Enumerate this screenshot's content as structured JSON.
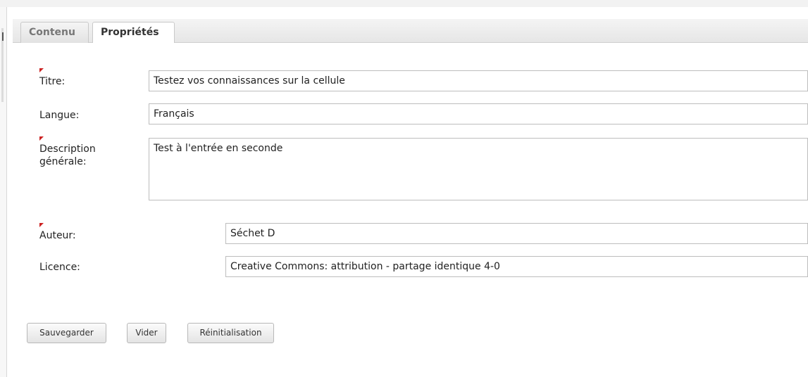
{
  "tabs": [
    {
      "label": "Contenu",
      "active": false
    },
    {
      "label": "Propriétés",
      "active": true
    }
  ],
  "form": {
    "title": {
      "label": "Titre:",
      "required": true,
      "value": "Testez vos connaissances sur la cellule"
    },
    "language": {
      "label": "Langue:",
      "required": false,
      "value": "Français"
    },
    "description": {
      "label": "Description générale:",
      "required": true,
      "value": "Test à l'entrée en seconde"
    },
    "author": {
      "label": "Auteur:",
      "required": true,
      "value": "Séchet D"
    },
    "license": {
      "label": "Licence:",
      "required": false,
      "value": "Creative Commons: attribution - partage identique 4-0"
    }
  },
  "buttons": {
    "save": "Sauvegarder",
    "clear": "Vider",
    "reset": "Réinitialisation"
  },
  "colors": {
    "required_marker": "#cc2222",
    "field_border": "#bdbdbd",
    "tab_active_bg": "#ffffff"
  }
}
